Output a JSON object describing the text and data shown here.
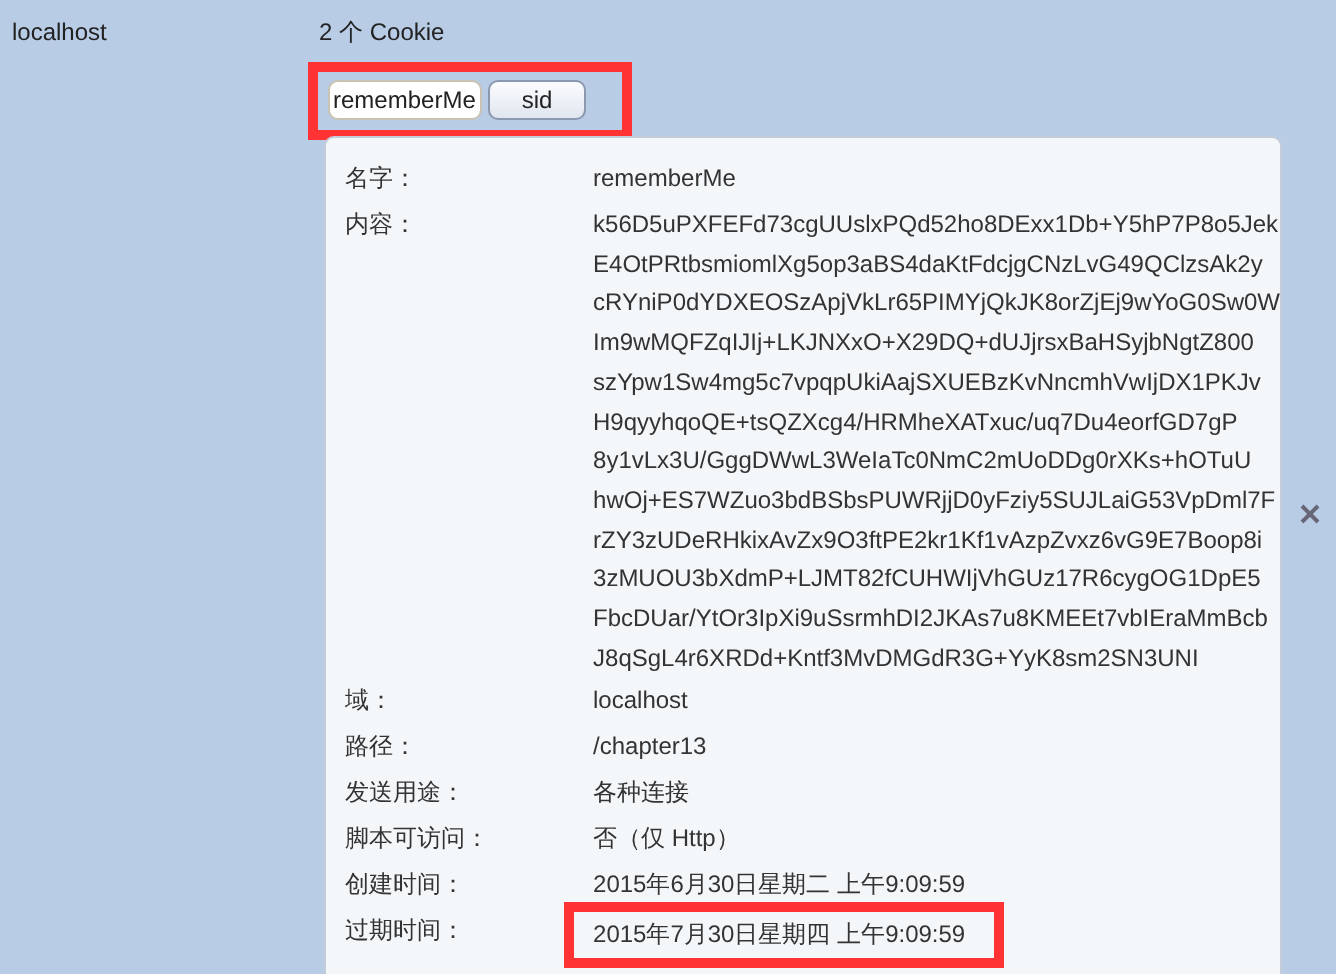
{
  "site": "localhost",
  "cookie_count": "2 个 Cookie",
  "cookies": [
    {
      "label": "rememberMe",
      "selected": true
    },
    {
      "label": "sid",
      "selected": false
    }
  ],
  "tabs_highlighted": true,
  "details": [
    {
      "kind": "text",
      "label": "名字：",
      "value": "rememberMe"
    },
    {
      "kind": "lines",
      "label": "内容：",
      "lines": [
        "k56D5uPXFEFd73cgUUslxPQd52ho8DExx1Db+Y5hP7P8o5Jek",
        "E4OtPRtbsmiomlXg5op3aBS4daKtFdcjgCNzLvG49QClzsAk2y",
        "cRYniP0dYDXEOSzApjVkLr65PIMYjQkJK8orZjEj9wYoG0Sw0W",
        "Im9wMQFZqIJIj+LKJNXxO+X29DQ+dUJjrsxBaHSyjbNgtZ800",
        "szYpw1Sw4mg5c7vpqpUkiAajSXUEBzKvNncmhVwIjDX1PKJv",
        "H9qyyhqoQE+tsQZXcg4/HRMheXATxuc/uq7Du4eorfGD7gP",
        "8y1vLx3U/GggDWwL3WeIaTc0NmC2mUoDDg0rXKs+hOTuU",
        "hwOj+ES7WZuo3bdBSbsPUWRjjD0yFziy5SUJLaiG53VpDml7F",
        "rZY3zUDeRHkixAvZx9O3ftPE2kr1Kf1vAzpZvxz6vG9E7Boop8i",
        "3zMUOU3bXdmP+LJMT82fCUHWIjVhGUz17R6cygOG1DpE5",
        "FbcDUar/YtOr3IpXi9uSsrmhDI2JKAs7u8KMEEt7vbIEraMmBcb",
        "J8qSgL4r6XRDd+Kntf3MvDMGdR3G+YyK8sm2SN3UNI"
      ]
    },
    {
      "kind": "text",
      "label": "域：",
      "value": "localhost"
    },
    {
      "kind": "text",
      "label": "路径：",
      "value": "/chapter13"
    },
    {
      "kind": "text",
      "label": "发送用途：",
      "value": "各种连接"
    },
    {
      "kind": "text",
      "label": "脚本可访问：",
      "value": "否（仅 Http）"
    },
    {
      "kind": "text",
      "label": "创建时间：",
      "value": "2015年6月30日星期二 上午9:09:59"
    },
    {
      "kind": "text",
      "label": "过期时间：",
      "value": "2015年7月30日星期四 上午9:09:59",
      "highlighted": true
    }
  ]
}
